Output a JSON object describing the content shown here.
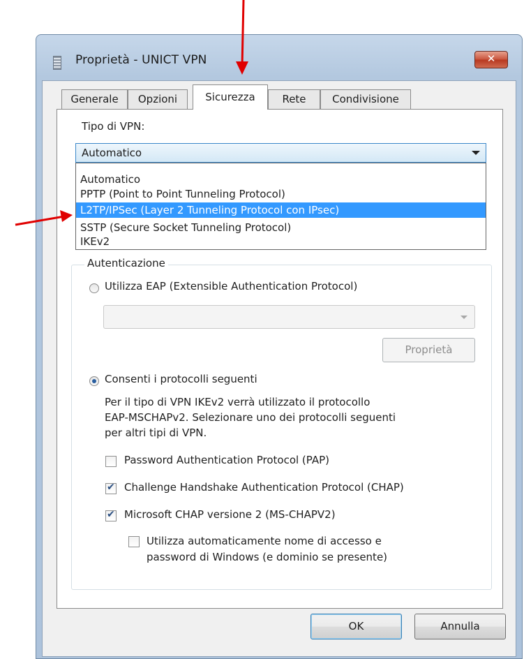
{
  "window": {
    "title": "Proprietà - UNICT VPN",
    "close_label": "✕"
  },
  "tabs": [
    {
      "label": "Generale",
      "active": false
    },
    {
      "label": "Opzioni",
      "active": false
    },
    {
      "label": "Sicurezza",
      "active": true
    },
    {
      "label": "Rete",
      "active": false
    },
    {
      "label": "Condivisione",
      "active": false
    }
  ],
  "vpn_type": {
    "label": "Tipo di VPN:",
    "selected": "Automatico",
    "options": [
      "Automatico",
      "PPTP (Point to Point Tunneling Protocol)",
      "L2TP/IPSec (Layer 2 Tunneling Protocol con IPsec)",
      "SSTP (Secure Socket Tunneling Protocol)",
      "IKEv2"
    ],
    "highlighted_option": "L2TP/IPSec (Layer 2 Tunneling Protocol con IPsec)"
  },
  "auth": {
    "legend": "Autenticazione",
    "eap_radio_label": "Utilizza EAP (Extensible Authentication Protocol)",
    "eap_selected": false,
    "eap_combo_value": "",
    "properties_button": "Proprietà",
    "allow_radio_label": "Consenti i protocolli seguenti",
    "allow_selected": true,
    "description_lines": [
      "Per il tipo di VPN IKEv2 verrà utilizzato il protocollo",
      "EAP-MSCHAPv2. Selezionare uno dei protocolli seguenti",
      "per altri tipi di VPN."
    ],
    "protocols": [
      {
        "label": "Password Authentication Protocol (PAP)",
        "checked": false
      },
      {
        "label": "Challenge Handshake Authentication Protocol (CHAP)",
        "checked": true
      },
      {
        "label": "Microsoft CHAP versione 2 (MS-CHAPV2)",
        "checked": true
      }
    ],
    "auto_logon": {
      "lines": [
        "Utilizza automaticamente nome di accesso e",
        "password di Windows (e dominio se presente)"
      ],
      "checked": false
    }
  },
  "buttons": {
    "ok": "OK",
    "cancel": "Annulla"
  },
  "colors": {
    "selection": "#3399ff",
    "annotation_arrow": "#e00000",
    "close_button": "#c9533b"
  }
}
